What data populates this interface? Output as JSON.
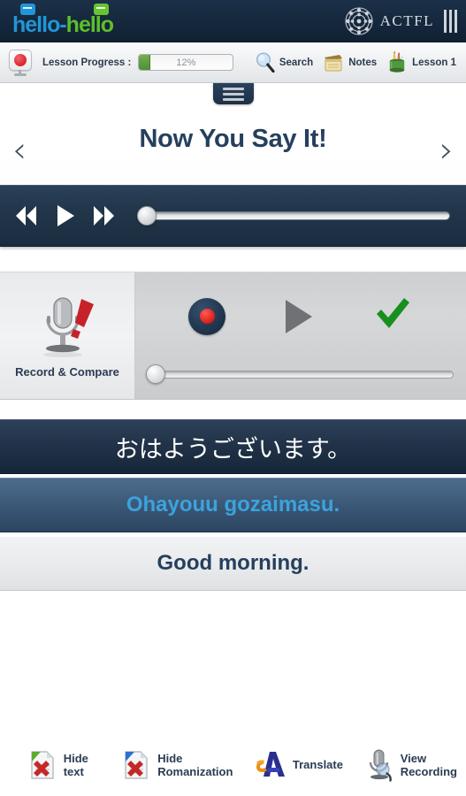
{
  "brand": {
    "logo_text_part1": "hello",
    "logo_separator": "-",
    "logo_text_part2": "hello",
    "partner_name": "ACTFL",
    "colors": {
      "logo_blue": "#2196d6",
      "logo_green": "#5cbf2a",
      "header_bg": "#16293e",
      "accent_navy": "#25405e",
      "record_red": "#d71a15",
      "progress_green": "#4f8f36",
      "roman_text_blue": "#3ba3dd"
    }
  },
  "status": {
    "language_flag": "japan-flag-icon",
    "progress_label": "Lesson Progress :",
    "progress_percent_text": "12%",
    "progress_percent_value": 12,
    "actions": [
      {
        "label": "Search",
        "icon": "search-icon"
      },
      {
        "label": "Notes",
        "icon": "notes-icon"
      },
      {
        "label": "Lesson 1",
        "icon": "lesson-icon"
      }
    ]
  },
  "header": {
    "menu_tab_icon": "hamburger-menu-icon",
    "prev_icon": "‹",
    "next_icon": "›",
    "title": "Now You Say It!"
  },
  "player": {
    "rewind_icon": "rewind-icon",
    "play_icon": "play-icon",
    "forward_icon": "fast-forward-icon",
    "seek_value": 0
  },
  "record_compare": {
    "panel_label": "Record & Compare",
    "panel_icon": "microphone-check-icon",
    "record_button_icon": "record-icon",
    "playback_button_icon": "play-icon",
    "confirm_button_icon": "checkmark-icon",
    "seek_value": 0
  },
  "phrase": {
    "native": "おはようございます。",
    "romanization": "Ohayouu gozaimasu.",
    "translation": "Good morning."
  },
  "bottom_toolbar": [
    {
      "label_line1": "Hide",
      "label_line2": "text",
      "icon": "hide-text-icon"
    },
    {
      "label_line1": "Hide",
      "label_line2": "Romanization",
      "icon": "hide-romanization-icon"
    },
    {
      "label_line1": "Translate",
      "label_line2": "",
      "icon": "translate-icon"
    },
    {
      "label_line1": "View",
      "label_line2": "Recording",
      "icon": "view-recording-icon"
    }
  ]
}
